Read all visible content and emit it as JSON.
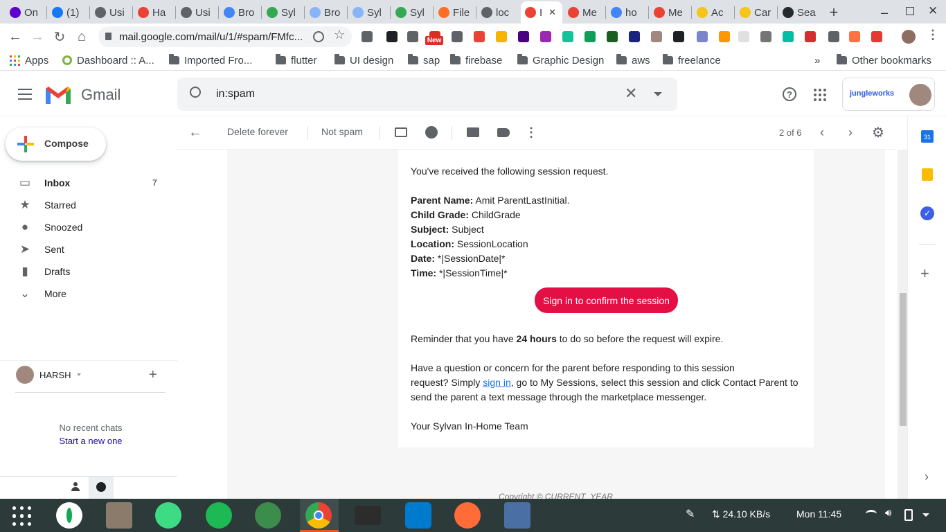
{
  "browser": {
    "tabs": [
      {
        "label": "On",
        "icon": "yahoo-icon",
        "color": "#5f01d1"
      },
      {
        "label": "(1)",
        "icon": "messenger-icon",
        "color": "#1877f2"
      },
      {
        "label": "Usi",
        "icon": "globe-icon",
        "color": "#5f6368"
      },
      {
        "label": "Ha",
        "icon": "gmail-icon",
        "color": "#ea4335"
      },
      {
        "label": "Usi",
        "icon": "globe-icon",
        "color": "#5f6368"
      },
      {
        "label": "Bro",
        "icon": "bucket-icon",
        "color": "#4285f4"
      },
      {
        "label": "Syl",
        "icon": "sylvan-icon",
        "color": "#34a853"
      },
      {
        "label": "Bro",
        "icon": "bucket-icon",
        "color": "#8ab4f8"
      },
      {
        "label": "Syl",
        "icon": "bucket-icon",
        "color": "#8ab4f8"
      },
      {
        "label": "Syl",
        "icon": "sylvan-icon",
        "color": "#34a853"
      },
      {
        "label": "File",
        "icon": "gitlab-icon",
        "color": "#fc6d26"
      },
      {
        "label": "loc",
        "icon": "globe-icon",
        "color": "#5f6368"
      },
      {
        "label": "I",
        "icon": "gmail-icon",
        "color": "#ea4335"
      },
      {
        "label": "Me",
        "icon": "gmail-icon",
        "color": "#ea4335"
      },
      {
        "label": "ho",
        "icon": "google-icon",
        "color": "#4285f4"
      },
      {
        "label": "Me",
        "icon": "gmail-icon",
        "color": "#ea4335"
      },
      {
        "label": "Ac",
        "icon": "coin-icon",
        "color": "#f5c518"
      },
      {
        "label": "Car",
        "icon": "coin-icon",
        "color": "#f5c518"
      },
      {
        "label": "Sea",
        "icon": "github-icon",
        "color": "#24292e"
      }
    ],
    "url": "mail.google.com/mail/u/1/#spam/FMfc...",
    "new_badge": "New",
    "bookmarks": [
      {
        "label": "Apps",
        "icon": "apps-grid-icon"
      },
      {
        "label": "Dashboard :: A...",
        "icon": "dashboard-icon"
      },
      {
        "label": "Imported Fro...",
        "icon": "folder-icon"
      },
      {
        "label": "flutter",
        "icon": "folder-icon"
      },
      {
        "label": "UI design",
        "icon": "folder-icon"
      },
      {
        "label": "sap",
        "icon": "folder-icon"
      },
      {
        "label": "firebase",
        "icon": "folder-icon"
      },
      {
        "label": "Graphic Design",
        "icon": "folder-icon"
      },
      {
        "label": "aws",
        "icon": "folder-icon"
      },
      {
        "label": "freelance",
        "icon": "folder-icon"
      }
    ],
    "overflow": "»",
    "other_bookmarks": "Other bookmarks"
  },
  "gmail": {
    "product": "Gmail",
    "search_value": "in:spam",
    "account_brand": "jungleworks",
    "compose": "Compose",
    "nav": [
      {
        "label": "Inbox",
        "count": "7",
        "icon": "inbox-icon",
        "bold": true
      },
      {
        "label": "Starred",
        "count": "",
        "icon": "star-icon"
      },
      {
        "label": "Snoozed",
        "count": "",
        "icon": "clock-icon"
      },
      {
        "label": "Sent",
        "count": "",
        "icon": "send-icon"
      },
      {
        "label": "Drafts",
        "count": "",
        "icon": "draft-icon"
      },
      {
        "label": "More",
        "count": "",
        "icon": "chevron-down-icon"
      }
    ],
    "hangouts_user": "HARSH",
    "no_chats": "No recent chats",
    "start_new": "Start a new one",
    "actions": {
      "delete_forever": "Delete forever",
      "not_spam": "Not spam"
    },
    "pager": "2 of 6"
  },
  "email": {
    "intro": "You've received the following session request.",
    "fields": [
      {
        "label": "Parent Name:",
        "value": " Amit ParentLastInitial."
      },
      {
        "label": "Child Grade:",
        "value": " ChildGrade"
      },
      {
        "label": "Subject:",
        "value": " Subject"
      },
      {
        "label": "Location:",
        "value": " SessionLocation"
      },
      {
        "label": "Date:",
        "value": " *|SessionDate|*"
      },
      {
        "label": "Time:",
        "value": " *|SessionTime|*"
      }
    ],
    "cta": "Sign in to confirm the session",
    "reminder_pre": "Reminder that you have ",
    "reminder_bold": "24 hours",
    "reminder_post": " to do so before the request will expire.",
    "question_line1": "Have a question or concern for the parent before responding to this session",
    "question_line2_pre": "request? Simply ",
    "question_link": "sign in",
    "question_line2_post": ", go to My Sessions, select this session and click Contact Parent to",
    "question_line3": "send the parent a text message through the marketplace messenger.",
    "signoff": "Your Sylvan In-Home Team",
    "copyright": "Copyright © CURRENT_YEAR"
  },
  "taskbar": {
    "network": "⇅ 24.10 KB/s",
    "clock": "Mon 11:45"
  },
  "colors": {
    "cta": "#e30f45",
    "link": "#1a73e8",
    "hangouts_link": "#1a0dab"
  }
}
